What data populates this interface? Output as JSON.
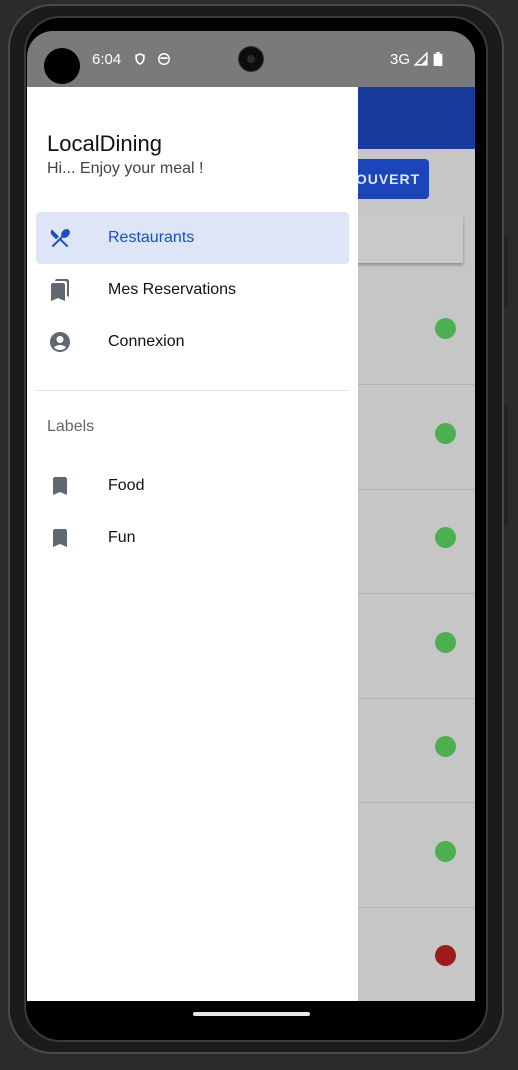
{
  "status_bar": {
    "time": "6:04",
    "network": "3G",
    "icons": [
      "shield-icon",
      "face-icon",
      "signal-icon",
      "battery-icon"
    ]
  },
  "background_app": {
    "button_label": "OUVERT",
    "status_dots": [
      "#4caf50",
      "#4caf50",
      "#4caf50",
      "#4caf50",
      "#4caf50",
      "#4caf50",
      "#9e1b1b"
    ]
  },
  "drawer": {
    "title": "LocalDining",
    "subtitle": "Hi... Enjoy your meal !",
    "items": [
      {
        "label": "Restaurants",
        "icon": "restaurant-icon",
        "active": true
      },
      {
        "label": "Mes Reservations",
        "icon": "bookmarks-icon",
        "active": false
      },
      {
        "label": "Connexion",
        "icon": "account-circle-icon",
        "active": false
      }
    ],
    "labels_heading": "Labels",
    "labels": [
      {
        "label": "Food",
        "icon": "bookmark-icon"
      },
      {
        "label": "Fun",
        "icon": "bookmark-icon"
      }
    ]
  },
  "colors": {
    "accent": "#1a4fbf",
    "active_bg": "#dde5f6",
    "appbar": "#1a3b9e",
    "icon_gray": "#5f6773"
  }
}
